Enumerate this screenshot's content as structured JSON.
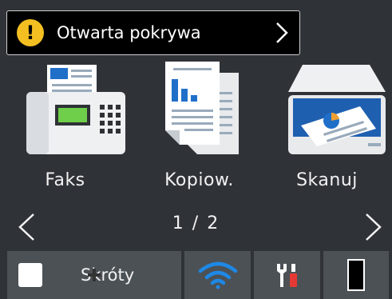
{
  "alert": {
    "text": "Otwarta pokrywa",
    "icon": "warning-icon",
    "icon_glyph": "!",
    "color": "#f4c021"
  },
  "tiles": [
    {
      "label": "Faks",
      "icon": "fax-icon"
    },
    {
      "label": "Kopiow.",
      "icon": "copy-icon"
    },
    {
      "label": "Skanuj",
      "icon": "scan-icon"
    }
  ],
  "pager": {
    "text": "1 / 2"
  },
  "bottom": {
    "shortcuts_label": "Skróty",
    "wifi_icon": "wifi-icon",
    "settings_icon": "settings-tools-icon",
    "toner_icon": "toner-icon",
    "wifi_color": "#1e88e5"
  }
}
